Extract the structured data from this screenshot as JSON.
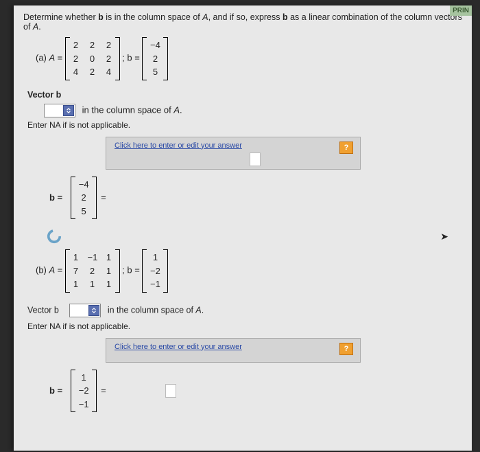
{
  "topbar": "PRIN",
  "instruction_pre": "Determine whether ",
  "instruction_b": "b",
  "instruction_mid": " is in the column space of ",
  "instruction_A": "A",
  "instruction_post": ", and if so, express ",
  "instruction_b2": "b",
  "instruction_end": " as a linear combination of the column vectors of ",
  "instruction_A2": "A",
  "instruction_dot": ".",
  "a": {
    "label": "(a)",
    "Aeq": "A =",
    "matrix": [
      [
        "2",
        "2",
        "2"
      ],
      [
        "2",
        "0",
        "2"
      ],
      [
        "4",
        "2",
        "4"
      ]
    ],
    "sep": "; b =",
    "vector": [
      "−4",
      "2",
      "5"
    ]
  },
  "vecb_label": "Vector b",
  "colspace_text": " in the column space of ",
  "A_char": "A",
  "hint": "Enter NA if is not applicable.",
  "ans": {
    "toplink": "Click here to enter or edit your answer",
    "help": "?"
  },
  "veq_pre": "b =",
  "veq_vector_a": [
    "−4",
    "2",
    "5"
  ],
  "veq_eq": "=",
  "b": {
    "label": "(b)",
    "Aeq": "A =",
    "matrix": [
      [
        "1",
        "−1",
        "1"
      ],
      [
        "7",
        "2",
        "1"
      ],
      [
        "1",
        "1",
        "1"
      ]
    ],
    "sep": "; b =",
    "vector": [
      "1",
      "−2",
      "−1"
    ]
  },
  "vecb_label2": "Vector b",
  "colspace_text2": " in the column space of ",
  "A_char2": "A",
  "hint2": "Enter NA if is not applicable.",
  "veq_vector_b": [
    "1",
    "−2",
    "−1"
  ]
}
